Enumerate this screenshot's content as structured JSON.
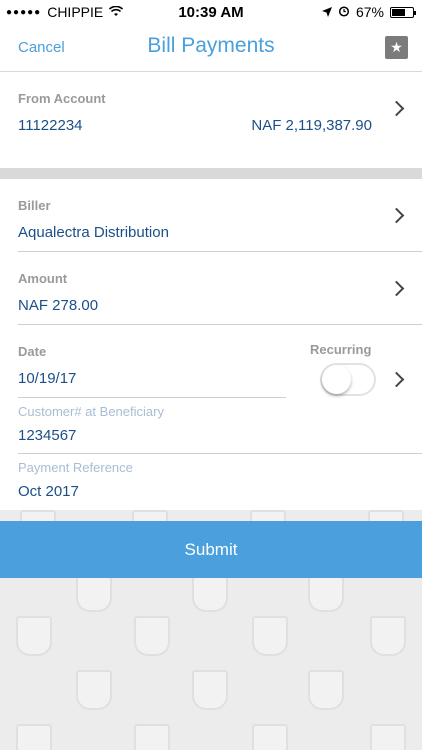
{
  "status_bar": {
    "carrier": "CHIPPIE",
    "time": "10:39 AM",
    "battery": "67%",
    "battery_level": 0.67
  },
  "nav": {
    "cancel": "Cancel",
    "title": "Bill Payments",
    "favorite_icon": "star-icon"
  },
  "from_account": {
    "label": "From Account",
    "number": "11122234",
    "balance": "NAF 2,119,387.90"
  },
  "biller": {
    "label": "Biller",
    "value": "Aqualectra Distribution"
  },
  "amount": {
    "label": "Amount",
    "value": "NAF 278.00"
  },
  "date": {
    "label": "Date",
    "value": "10/19/17"
  },
  "recurring": {
    "label": "Recurring",
    "on": false
  },
  "customer_number": {
    "label": "Customer# at Beneficiary",
    "value": "1234567"
  },
  "payment_reference": {
    "label": "Payment Reference",
    "value": "Oct 2017"
  },
  "submit": {
    "label": "Submit"
  },
  "colors": {
    "accent": "#4a9fdc",
    "value_text": "#1b4f8a"
  }
}
